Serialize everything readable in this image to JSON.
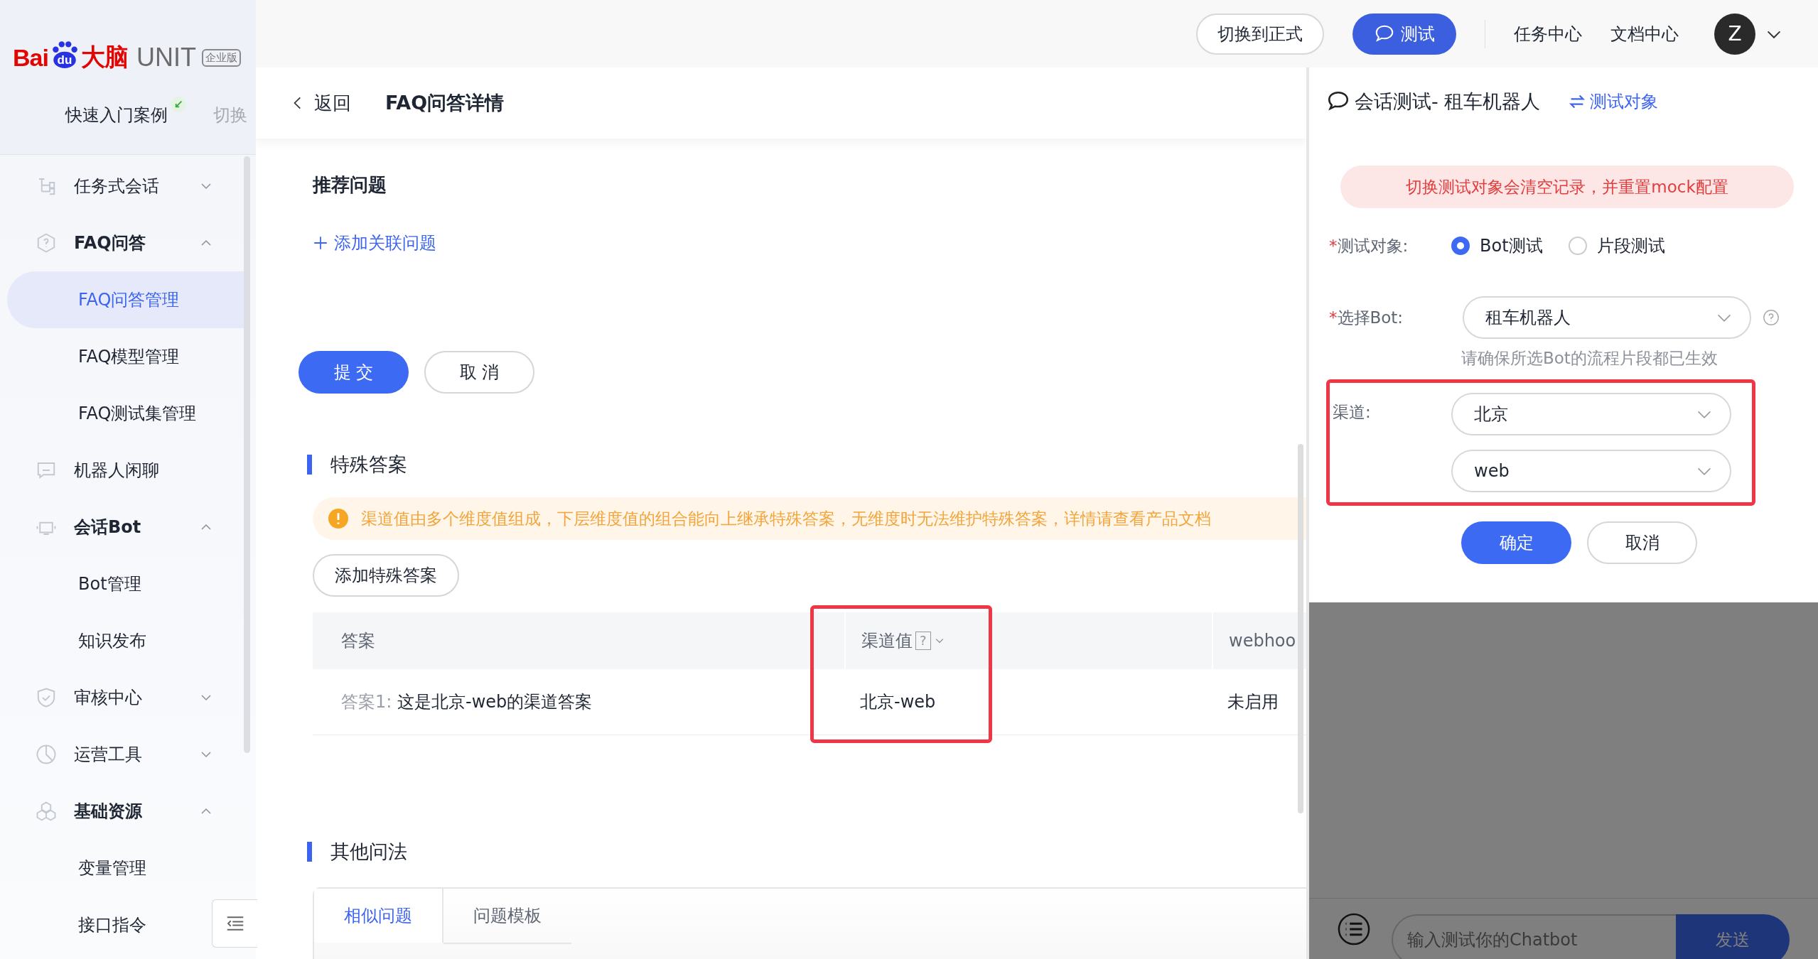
{
  "logo": {
    "brand": "Bai",
    "paw": "du",
    "brand_cn": "大脑",
    "product": "UNIT",
    "edition": "企业版"
  },
  "project": {
    "name": "快速入门案例",
    "switch": "切换"
  },
  "sidebar": {
    "items": [
      {
        "label": "任务式会话",
        "kind": "tree",
        "expanded": false
      },
      {
        "label": "FAQ问答",
        "kind": "faq",
        "expanded": true,
        "children": [
          {
            "label": "FAQ问答管理",
            "selected": true
          },
          {
            "label": "FAQ模型管理",
            "selected": false
          },
          {
            "label": "FAQ测试集管理",
            "selected": false
          }
        ]
      },
      {
        "label": "机器人闲聊",
        "kind": "chat"
      },
      {
        "label": "会话Bot",
        "kind": "bot",
        "expanded": true,
        "children": [
          {
            "label": "Bot管理",
            "selected": false
          },
          {
            "label": "知识发布",
            "selected": false
          }
        ]
      },
      {
        "label": "审核中心",
        "kind": "shield",
        "expanded": false
      },
      {
        "label": "运营工具",
        "kind": "pie",
        "expanded": false
      },
      {
        "label": "基础资源",
        "kind": "hex",
        "expanded": true,
        "children": [
          {
            "label": "变量管理",
            "selected": false
          },
          {
            "label": "接口指令",
            "selected": false
          }
        ]
      }
    ]
  },
  "topbar": {
    "switch_button": "切换到正式",
    "test_button": "测试",
    "links": [
      "任务中心",
      "文档中心"
    ],
    "avatar": "Z"
  },
  "header": {
    "back": "返回",
    "title": "FAQ问答详情"
  },
  "recommend": {
    "title": "推荐问题",
    "add_link": "添加关联问题",
    "submit": "提 交",
    "cancel": "取 消"
  },
  "special": {
    "title": "特殊答案",
    "warning": "渠道值由多个维度值组成，下层维度值的组合能向上继承特殊答案，无维度时无法维护特殊答案，详情请查看产品文档",
    "add_button": "添加特殊答案",
    "table": {
      "columns": [
        {
          "label": "答案"
        },
        {
          "label": "渠道值",
          "help": "?",
          "highlighted": true
        },
        {
          "label": "webhoo"
        }
      ],
      "rows": [
        {
          "prefix": "答案1:",
          "answer": "这是北京-web的渠道答案",
          "channel": "北京-web",
          "webhook": "未启用"
        }
      ]
    }
  },
  "other": {
    "title": "其他问法",
    "tabs": [
      {
        "label": "相似问题",
        "selected": true
      },
      {
        "label": "问题模板",
        "selected": false
      }
    ]
  },
  "test_panel": {
    "title": "会话测试- 租车机器人",
    "switch_link": "测试对象",
    "alert": "切换测试对象会清空记录，并重置mock配置",
    "required_mark": "*",
    "target_label": "测试对象:",
    "targets": [
      {
        "label": "Bot测试",
        "selected": true
      },
      {
        "label": "片段测试",
        "selected": false
      }
    ],
    "bot_label": "选择Bot:",
    "bot_value": "租车机器人",
    "bot_hint": "请确保所选Bot的流程片段都已生效",
    "channel_label": "渠道:",
    "channel_highlighted": true,
    "channels": [
      "北京",
      "web"
    ],
    "confirm": "确定",
    "cancel": "取消",
    "chat_placeholder": "输入测试你的Chatbot",
    "send": "发送"
  }
}
